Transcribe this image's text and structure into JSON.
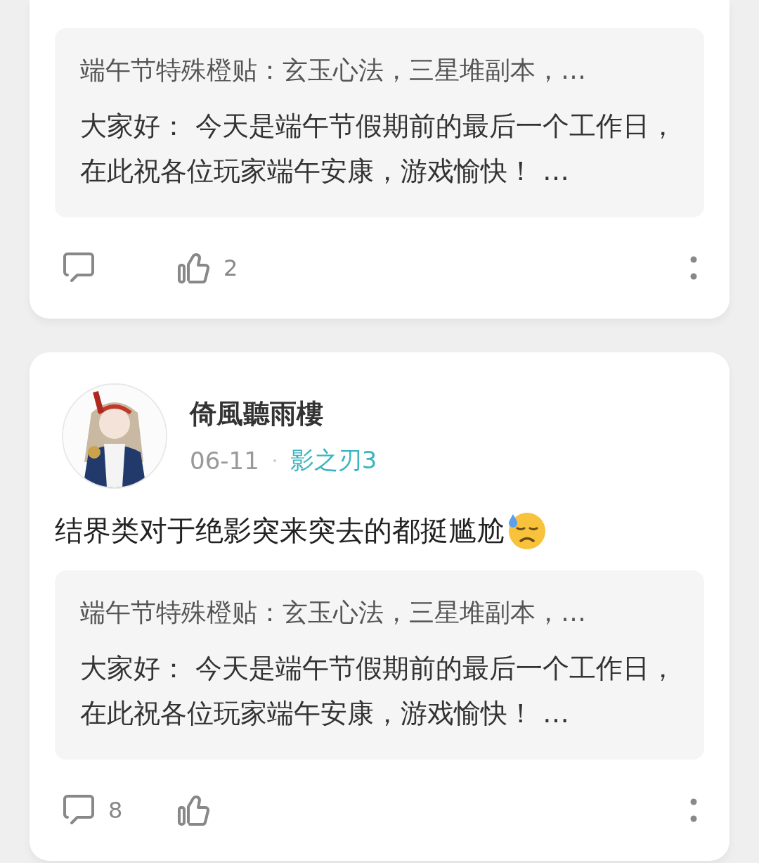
{
  "posts": [
    {
      "quote": {
        "title": "端午节特殊橙贴：玄玉心法，三星堆副本，…",
        "body": "大家好： 今天是端午节假期前的最后一个工作日，在此祝各位玩家端午安康，游戏愉快！ …"
      },
      "likes": "2"
    },
    {
      "author": {
        "name": "倚風聽雨樓"
      },
      "date": "06-11",
      "tag": "影之刃3",
      "text": "结界类对于绝影突来突去的都挺尴尬",
      "quote": {
        "title": "端午节特殊橙贴：玄玉心法，三星堆副本，…",
        "body": "大家好： 今天是端午节假期前的最后一个工作日，在此祝各位玩家端午安康，游戏愉快！ …"
      },
      "comments": "8"
    }
  ]
}
